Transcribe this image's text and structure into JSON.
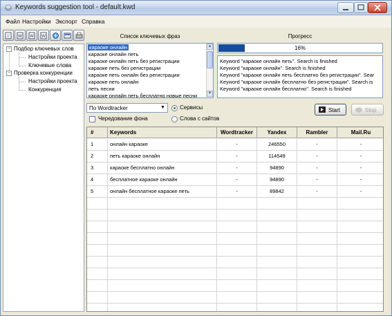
{
  "window": {
    "title": "Keywords suggestion tool - default.kwd"
  },
  "menu": [
    "Файл",
    "Настройки",
    "Экспорт",
    "Справка"
  ],
  "toolbar": [
    "new-icon",
    "open-icon",
    "save-icon",
    "save-as-icon",
    "export-icon",
    "settings-icon",
    "print-icon"
  ],
  "tree": {
    "groups": [
      {
        "label": "Подбор ключевых слов",
        "children": [
          "Настройки проекта",
          "Ключевые слова"
        ]
      },
      {
        "label": "Проверка конкуренции",
        "children": [
          "Настройки проекта",
          "Конкуренция"
        ]
      }
    ]
  },
  "phrases": {
    "header": "Список ключевых фраз",
    "items": [
      "караоке онлайн",
      "караоке онлайн петь",
      "караоке онлайн петь без регистрации",
      "караоке петь без регистрации",
      "караоке петь онлайн без регистрации",
      "караоке петь онлайн",
      "петь песни",
      "караоке онлайн петь бесплатно новые песни"
    ],
    "selected_index": 0
  },
  "progress": {
    "header": "Прогресс",
    "value": 16,
    "text": "16%"
  },
  "log": [
    "Keyword \"караоке онлайн петь\". Search is finished",
    "Keyword \"караоке онлайн\". Search is finished",
    "Keyword \"караоке онлайн петь бесплатно без регистрации\". Sear",
    "Keyword \"караоке онлайн бесплатно без регистрации\". Search is",
    "Keyword \"караоке онлайн бесплатно\". Search is finished"
  ],
  "controls": {
    "source_select": "По Wordtracker",
    "radio_services": "Сервисы",
    "radio_sites": "Слова с сайтов",
    "checkbox_alternate": "Чередование фона",
    "start": "Start",
    "stop": "Stop"
  },
  "table": {
    "headers": [
      "#",
      "Keywords",
      "Wordtracker",
      "Yandex",
      "Rambler",
      "Mail.Ru"
    ],
    "rows": [
      [
        "1",
        "онлайн караоке",
        "-",
        "246550",
        "-",
        "-"
      ],
      [
        "2",
        "петь караоке онлайн",
        "-",
        "114549",
        "-",
        "-"
      ],
      [
        "3",
        "караоке бесплатно онлайн",
        "-",
        "94890",
        "-",
        "-"
      ],
      [
        "4",
        "бесплатное караоке онлайн",
        "-",
        "94890",
        "-",
        "-"
      ],
      [
        "5",
        "онлайн бесплатное караоке петь",
        "-",
        "89842",
        "-",
        "-"
      ]
    ]
  },
  "colors": {
    "selection": "#316ac5",
    "progress_fill": "#174c9a",
    "window_face": "#ece9d8"
  }
}
